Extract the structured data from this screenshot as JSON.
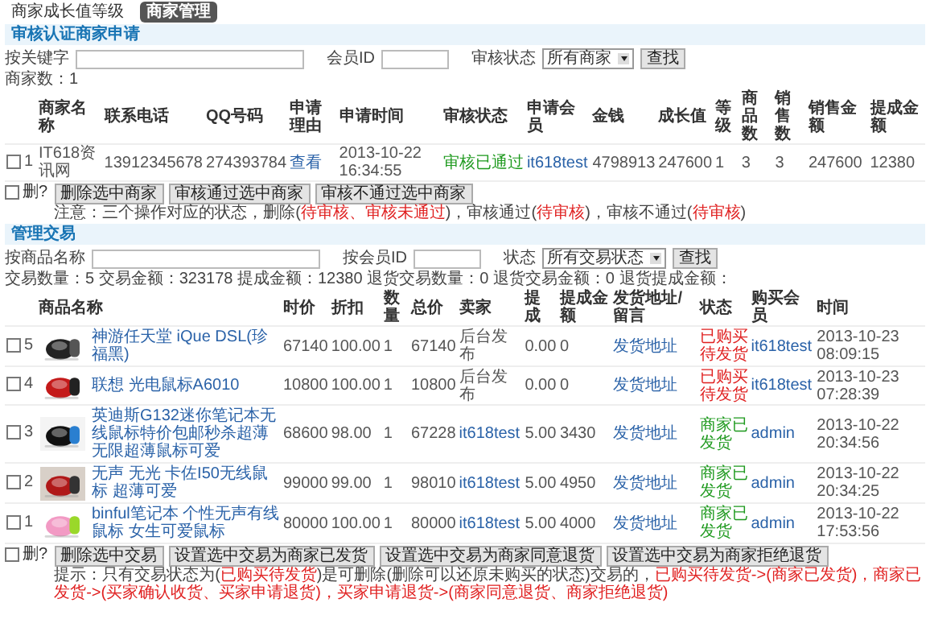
{
  "top_nav": [
    {
      "label": "商家成长值等级",
      "selected": false
    },
    {
      "label": "商家管理",
      "selected": true
    }
  ],
  "merchant_review": {
    "title": "审核认证商家申请",
    "filters": [
      {
        "kind": "input",
        "label": "按关键字"
      },
      {
        "kind": "input",
        "label": "会员ID"
      },
      {
        "kind": "select",
        "label": "审核状态",
        "value": "所有商家"
      }
    ],
    "search_button": "查找",
    "count": "商家数：1",
    "columns": [
      "商家名称",
      "联系电话",
      "QQ号码",
      "申请理由",
      "申请时间",
      "审核状态",
      "申请会员",
      "金钱",
      "成长值",
      "等级",
      "商品数",
      "销售数",
      "销售金额",
      "提成金额"
    ],
    "rows": [
      {
        "checked": false,
        "number": "1",
        "cells": [
          {
            "kind": "text",
            "text": "IT618资讯网"
          },
          {
            "kind": "text",
            "text": "13912345678"
          },
          {
            "kind": "text",
            "text": "274393784"
          },
          {
            "kind": "link",
            "text": "查看"
          },
          {
            "kind": "text",
            "text": "2013-10-22 16:34:55"
          },
          {
            "kind": "status",
            "text": "审核已通过",
            "color": "#1f9a1f"
          },
          {
            "kind": "link",
            "text": "it618test"
          },
          {
            "kind": "text",
            "text": "4798913"
          },
          {
            "kind": "text",
            "text": "247600"
          },
          {
            "kind": "text",
            "text": "1"
          },
          {
            "kind": "text",
            "text": "3"
          },
          {
            "kind": "text",
            "text": "3"
          },
          {
            "kind": "text",
            "text": "247600"
          },
          {
            "kind": "text",
            "text": "12380"
          }
        ]
      }
    ],
    "select_all": {
      "label": "删?",
      "checked": false
    },
    "buttons": [
      "删除选中商家",
      "审核通过选中商家",
      "审核不通过选中商家"
    ],
    "note": [
      {
        "kind": "plain",
        "text": "注意：三个操作对应的状态，删除("
      },
      {
        "kind": "alert",
        "text": "待审核、审核未通过"
      },
      {
        "kind": "plain",
        "text": ")，审核通过("
      },
      {
        "kind": "alert",
        "text": "待审核"
      },
      {
        "kind": "plain",
        "text": ")，审核不通过("
      },
      {
        "kind": "alert",
        "text": "待审核"
      },
      {
        "kind": "plain",
        "text": ")"
      }
    ]
  },
  "trades": {
    "title": "管理交易",
    "filters": [
      {
        "kind": "input",
        "label": "按商品名称"
      },
      {
        "kind": "input",
        "label": "按会员ID"
      },
      {
        "kind": "select",
        "label": "状态",
        "value": "所有交易状态"
      }
    ],
    "search_button": "查找",
    "summary": "交易数量：5 交易金额：323178 提成金额：12380 退货交易数量：0 退货交易金额：0 退货提成金额：",
    "columns": [
      "商品名称",
      "时价",
      "折扣",
      "数量",
      "总价",
      "卖家",
      "提成",
      "提成金额",
      "发货地址/留言",
      "状态",
      "购买会员",
      "时间"
    ],
    "rows": [
      {
        "checked": false,
        "number": "5",
        "cells": [
          {
            "kind": "product",
            "text": "神游任天堂 iQue DSL(珍福黑)"
          },
          {
            "kind": "text",
            "text": "67140"
          },
          {
            "kind": "text",
            "text": "100.00"
          },
          {
            "kind": "text",
            "text": "1"
          },
          {
            "kind": "text",
            "text": "67140"
          },
          {
            "kind": "text",
            "text": "后台发布"
          },
          {
            "kind": "text",
            "text": "0.00"
          },
          {
            "kind": "text",
            "text": "0"
          },
          {
            "kind": "link",
            "text": "发货地址"
          },
          {
            "kind": "status",
            "text": "已购买待发货",
            "color": "#e02020"
          },
          {
            "kind": "link",
            "text": "it618test"
          },
          {
            "kind": "text",
            "text": "2013-10-23 08:09:15"
          }
        ]
      },
      {
        "checked": false,
        "number": "4",
        "cells": [
          {
            "kind": "product",
            "text": "联想 光电鼠标A6010"
          },
          {
            "kind": "text",
            "text": "10800"
          },
          {
            "kind": "text",
            "text": "100.00"
          },
          {
            "kind": "text",
            "text": "1"
          },
          {
            "kind": "text",
            "text": "10800"
          },
          {
            "kind": "text",
            "text": "后台发布"
          },
          {
            "kind": "text",
            "text": "0.00"
          },
          {
            "kind": "text",
            "text": "0"
          },
          {
            "kind": "link",
            "text": "发货地址"
          },
          {
            "kind": "status",
            "text": "已购买待发货",
            "color": "#e02020"
          },
          {
            "kind": "link",
            "text": "it618test"
          },
          {
            "kind": "text",
            "text": "2013-10-23 07:28:39"
          }
        ]
      },
      {
        "checked": false,
        "number": "3",
        "cells": [
          {
            "kind": "product",
            "text": "英迪斯G132迷你笔记本无线鼠标特价包邮秒杀超薄无限超薄鼠标可爱"
          },
          {
            "kind": "text",
            "text": "68600"
          },
          {
            "kind": "text",
            "text": "98.00"
          },
          {
            "kind": "text",
            "text": "1"
          },
          {
            "kind": "text",
            "text": "67228"
          },
          {
            "kind": "link",
            "text": "it618test"
          },
          {
            "kind": "text",
            "text": "5.00"
          },
          {
            "kind": "text",
            "text": "3430"
          },
          {
            "kind": "link",
            "text": "发货地址"
          },
          {
            "kind": "status",
            "text": "商家已发货",
            "color": "#1f9a1f"
          },
          {
            "kind": "link",
            "text": "admin"
          },
          {
            "kind": "text",
            "text": "2013-10-22 20:34:56"
          }
        ]
      },
      {
        "checked": false,
        "number": "2",
        "cells": [
          {
            "kind": "product",
            "text": "无声 无光 卡佐I50无线鼠标 超薄可爱"
          },
          {
            "kind": "text",
            "text": "99000"
          },
          {
            "kind": "text",
            "text": "99.00"
          },
          {
            "kind": "text",
            "text": "1"
          },
          {
            "kind": "text",
            "text": "98010"
          },
          {
            "kind": "link",
            "text": "it618test"
          },
          {
            "kind": "text",
            "text": "5.00"
          },
          {
            "kind": "text",
            "text": "4950"
          },
          {
            "kind": "link",
            "text": "发货地址"
          },
          {
            "kind": "status",
            "text": "商家已发货",
            "color": "#1f9a1f"
          },
          {
            "kind": "link",
            "text": "admin"
          },
          {
            "kind": "text",
            "text": "2013-10-22 20:34:25"
          }
        ]
      },
      {
        "checked": false,
        "number": "1",
        "cells": [
          {
            "kind": "product",
            "text": "binful笔记本 个性无声有线鼠标 女生可爱鼠标"
          },
          {
            "kind": "text",
            "text": "80000"
          },
          {
            "kind": "text",
            "text": "100.00"
          },
          {
            "kind": "text",
            "text": "1"
          },
          {
            "kind": "text",
            "text": "80000"
          },
          {
            "kind": "link",
            "text": "it618test"
          },
          {
            "kind": "text",
            "text": "5.00"
          },
          {
            "kind": "text",
            "text": "4000"
          },
          {
            "kind": "link",
            "text": "发货地址"
          },
          {
            "kind": "status",
            "text": "商家已发货",
            "color": "#1f9a1f"
          },
          {
            "kind": "link",
            "text": "admin"
          },
          {
            "kind": "text",
            "text": "2013-10-22 17:53:56"
          }
        ]
      }
    ],
    "select_all": {
      "label": "删?",
      "checked": false
    },
    "buttons": [
      "删除选中交易",
      "设置选中交易为商家已发货",
      "设置选中交易为商家同意退货",
      "设置选中交易为商家拒绝退货"
    ],
    "note": [
      {
        "kind": "plain",
        "text": "提示：只有交易状态为("
      },
      {
        "kind": "alert",
        "text": "已购买待发货"
      },
      {
        "kind": "plain",
        "text": ")是可删除(删除可以还原未购买的状态)交易的，"
      },
      {
        "kind": "alert",
        "text": "已购买待发货->(商家已发货)，商家已发货->(买家确认收货、买家申请退货)，买家申请退货->(商家同意退货、商家拒绝退货)"
      }
    ]
  }
}
